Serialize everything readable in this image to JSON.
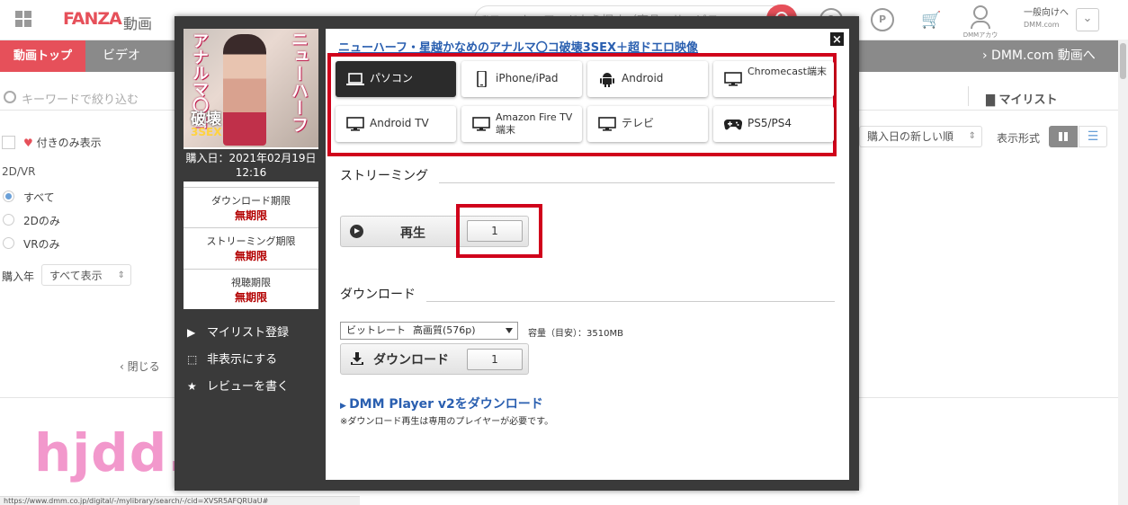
{
  "header": {
    "logo": "FANZA",
    "logo_sub": "動画",
    "search_category": "動画",
    "search_placeholder": "キーワードから探す（商品、サービス",
    "account_label": "DMMアカウント",
    "general_label_1": "一般向けへ",
    "general_label_2": "DMM.com",
    "help_glyph": "?",
    "point_glyph": "P"
  },
  "nav": {
    "top_label": "動画トップ",
    "video_label": "ビデオ",
    "dmm_link": "› DMM.com 動画へ"
  },
  "sidebar": {
    "filter_placeholder": "キーワードで絞り込む",
    "fav_only": "付きのみ表示",
    "vr_group_label": "2D/VR",
    "vr_options": [
      "すべて",
      "2Dのみ",
      "VRのみ"
    ],
    "vr_selected": "すべて",
    "year_label": "購入年",
    "year_value": "すべて表示",
    "close_label": "‹ 閉じる"
  },
  "toolbar": {
    "mylist_label": "マイリスト",
    "sort_value": "購入日の新しい順",
    "view_label": "表示形式"
  },
  "modal": {
    "title": "ニューハーフ・星越かなめのアナルマ〇コ破壊3SEX＋超ドエロ映像",
    "cover_text_1": "ニューハーフ",
    "cover_text_2": "アナルマ〇コ",
    "cover_text_3": "破壊",
    "cover_text_4": "3SEX",
    "purchase_date_label": "購入日：2021年02月19日",
    "purchase_time": "12:16",
    "limits": [
      {
        "label": "ダウンロード期限",
        "value": "無期限"
      },
      {
        "label": "ストリーミング期限",
        "value": "無期限"
      },
      {
        "label": "視聴期限",
        "value": "無期限"
      }
    ],
    "side_actions": [
      "マイリスト登録",
      "非表示にする",
      "レビューを書く"
    ],
    "devices": [
      {
        "label": "パソコン",
        "icon": "laptop-icon",
        "active": true
      },
      {
        "label": "iPhone/iPad",
        "icon": "smartphone-icon",
        "active": false
      },
      {
        "label": "Android",
        "icon": "android-icon",
        "active": false
      },
      {
        "label": "Chromecast端末",
        "icon": "monitor-icon",
        "active": false
      },
      {
        "label": "Android TV",
        "icon": "monitor-icon",
        "active": false
      },
      {
        "label": "Amazon Fire TV 端末",
        "icon": "monitor-icon",
        "active": false
      },
      {
        "label": "テレビ",
        "icon": "monitor-icon",
        "active": false
      },
      {
        "label": "PS5/PS4",
        "icon": "gamepad-icon",
        "active": false
      }
    ],
    "streaming_title": "ストリーミング",
    "play_label": "再生",
    "play_part": "1",
    "download_title": "ダウンロード",
    "bitrate_label": "ビットレート",
    "bitrate_value": "高画質(576p)",
    "size_text": "容量（目安）：3510MB",
    "download_label": "ダウンロード",
    "download_part": "1",
    "player_link": "DMM Player v2をダウンロード",
    "player_note": "※ダウンロード再生は専用のプレイヤーが必要です。"
  },
  "watermark": "hjdd.info",
  "status_url": "https://www.dmm.co.jp/digital/-/mylibrary/search/-/cid=XVSR5AFQRUaU#",
  "colors": {
    "accent": "#e6505a",
    "highlight": "#d0021b",
    "link": "#2a5fb0",
    "limit": "#b30000"
  }
}
